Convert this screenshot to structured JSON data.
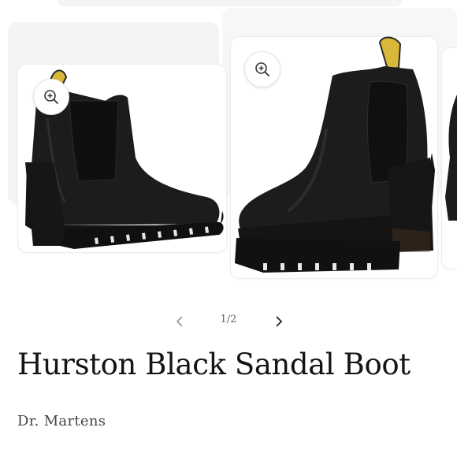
{
  "gallery": {
    "zoom_icon": "zoom-in-icon",
    "images": [
      {
        "alt": "Hurston Black Sandal Boot side view"
      },
      {
        "alt": "Hurston Black Sandal Boot angled view"
      }
    ],
    "pager": {
      "prev_icon": "chevron-left-icon",
      "next_icon": "chevron-right-icon",
      "count": "1/2"
    }
  },
  "product": {
    "title": "Hurston Black Sandal Boot",
    "brand": "Dr. Martens"
  },
  "colors": {
    "boot_leather": "#1c1c1c",
    "pull_tab": "#d8b73a",
    "sole": "#151515"
  }
}
